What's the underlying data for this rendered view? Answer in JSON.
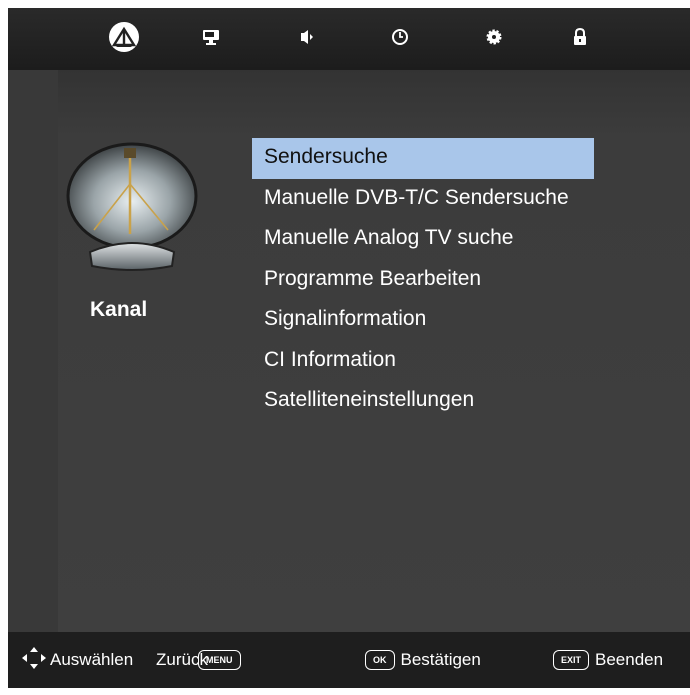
{
  "top_tabs": [
    {
      "name": "channel-tab",
      "icon": "satellite-dish-icon",
      "active": true
    },
    {
      "name": "picture-tab",
      "icon": "monitor-icon",
      "active": false
    },
    {
      "name": "sound-tab",
      "icon": "speaker-icon",
      "active": false
    },
    {
      "name": "time-tab",
      "icon": "clock-icon",
      "active": false
    },
    {
      "name": "setup-tab",
      "icon": "gear-icon",
      "active": false
    },
    {
      "name": "lock-tab",
      "icon": "lock-icon",
      "active": false
    }
  ],
  "section": {
    "title": "Kanal",
    "icon": "satellite-dish-icon"
  },
  "menu": {
    "items": [
      "Sendersuche",
      "Manuelle DVB-T/C Sendersuche",
      "Manuelle Analog TV suche",
      "Programme Bearbeiten",
      "Signalinformation",
      "CI Information",
      "Satelliteneinstellungen"
    ],
    "selected_index": 0
  },
  "footer": {
    "select_label": "Auswählen",
    "back_label": "Zurück",
    "menu_key": "MENU",
    "ok_key": "OK",
    "confirm_label": "Bestätigen",
    "exit_key": "EXIT",
    "exit_label": "Beenden"
  },
  "colors": {
    "selection": "#a9c6ea",
    "background": "#3f3f3f",
    "bar": "#1e1e1e"
  }
}
